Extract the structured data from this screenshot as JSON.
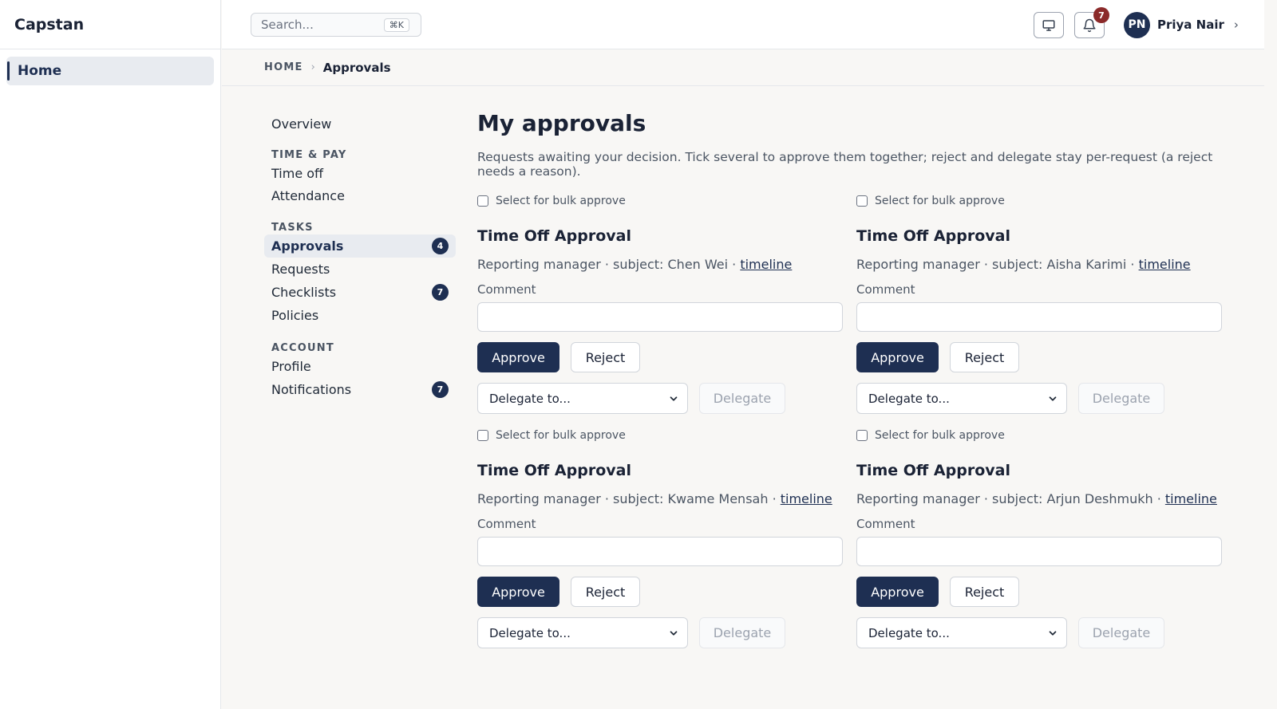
{
  "app": {
    "brand": "Capstan",
    "nav_home": "Home"
  },
  "topbar": {
    "search_placeholder": "Search...",
    "search_shortcut": "⌘K",
    "notifications_count": "7",
    "user_initials": "PN",
    "user_name": "Priya Nair"
  },
  "breadcrumb": {
    "home": "HOME",
    "separator": "›",
    "current": "Approvals"
  },
  "subnav": {
    "overview": "Overview",
    "time_pay_heading": "TIME & PAY",
    "time_off": "Time off",
    "attendance": "Attendance",
    "tasks_heading": "TASKS",
    "approvals": "Approvals",
    "approvals_count": "4",
    "requests": "Requests",
    "checklists": "Checklists",
    "checklists_count": "7",
    "policies": "Policies",
    "account_heading": "ACCOUNT",
    "profile": "Profile",
    "notifications": "Notifications",
    "notifications_count": "7"
  },
  "main": {
    "title": "My approvals",
    "intro": "Requests awaiting your decision. Tick several to approve them together; reject and delegate stay per-request (a reject needs a reason)."
  },
  "cards": [
    {
      "bulk_label": "Select for bulk approve",
      "title": "Time Off Approval",
      "meta": "Reporting manager · subject: Chen Wei · ",
      "timeline_link": "timeline",
      "comment_label": "Comment",
      "approve": "Approve",
      "reject": "Reject",
      "delegate_select": "Delegate to...",
      "delegate": "Delegate"
    },
    {
      "bulk_label": "Select for bulk approve",
      "title": "Time Off Approval",
      "meta": "Reporting manager · subject: Aisha Karimi · ",
      "timeline_link": "timeline",
      "comment_label": "Comment",
      "approve": "Approve",
      "reject": "Reject",
      "delegate_select": "Delegate to...",
      "delegate": "Delegate"
    },
    {
      "bulk_label": "Select for bulk approve",
      "title": "Time Off Approval",
      "meta": "Reporting manager · subject: Kwame Mensah · ",
      "timeline_link": "timeline",
      "comment_label": "Comment",
      "approve": "Approve",
      "reject": "Reject",
      "delegate_select": "Delegate to...",
      "delegate": "Delegate"
    },
    {
      "bulk_label": "Select for bulk approve",
      "title": "Time Off Approval",
      "meta": "Reporting manager · subject: Arjun Deshmukh · ",
      "timeline_link": "timeline",
      "comment_label": "Comment",
      "approve": "Approve",
      "reject": "Reject",
      "delegate_select": "Delegate to...",
      "delegate": "Delegate"
    }
  ]
}
